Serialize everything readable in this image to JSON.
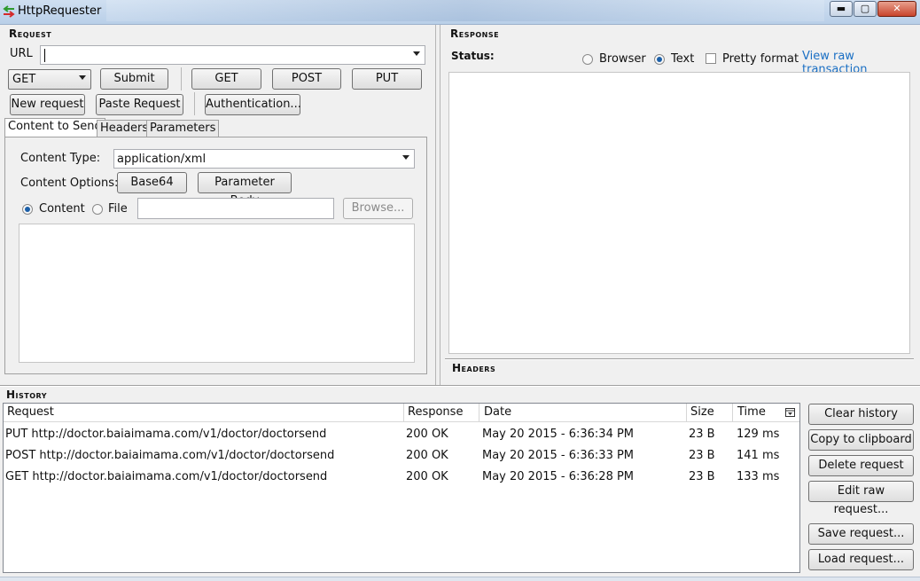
{
  "window": {
    "title": "HttpRequester",
    "controls": {
      "minimize": "▬",
      "maximize": "▢",
      "close": "✕"
    }
  },
  "request": {
    "section_title": "Request",
    "url_label": "URL",
    "url_value": "",
    "method_selected": "GET",
    "submit_label": "Submit",
    "get_label": "GET",
    "post_label": "POST",
    "put_label": "PUT",
    "new_request_label": "New request",
    "paste_request_label": "Paste Request",
    "authentication_label": "Authentication...",
    "tabs": [
      "Content to Send",
      "Headers",
      "Parameters"
    ],
    "content_type_label": "Content Type:",
    "content_type_value": "application/xml",
    "content_options_label": "Content Options:",
    "base64_label": "Base64",
    "parameter_body_label": "Parameter Body",
    "content_radio_label": "Content",
    "file_radio_label": "File",
    "file_path_value": "",
    "browse_label": "Browse...",
    "body_value": ""
  },
  "response": {
    "section_title": "Response",
    "status_label": "Status:",
    "browser_label": "Browser",
    "text_label": "Text",
    "pretty_format_label": "Pretty format",
    "view_raw_label": "View raw transaction",
    "headers_title": "Headers"
  },
  "history": {
    "section_title": "History",
    "columns": [
      "Request",
      "Response",
      "Date",
      "Size",
      "Time"
    ],
    "rows": [
      {
        "request": "PUT http://doctor.baiaimama.com/v1/doctor/doctorsend",
        "response": "200 OK",
        "date": "May 20 2015 - 6:36:34 PM",
        "size": "23 B",
        "time": "129 ms"
      },
      {
        "request": "POST http://doctor.baiaimama.com/v1/doctor/doctorsend",
        "response": "200 OK",
        "date": "May 20 2015 - 6:36:33 PM",
        "size": "23 B",
        "time": "141 ms"
      },
      {
        "request": "GET http://doctor.baiaimama.com/v1/doctor/doctorsend",
        "response": "200 OK",
        "date": "May 20 2015 - 6:36:28 PM",
        "size": "23 B",
        "time": "133 ms"
      }
    ],
    "clear_history_label": "Clear history",
    "copy_clipboard_label": "Copy to clipboard",
    "delete_request_label": "Delete request",
    "edit_raw_label": "Edit raw request...",
    "save_request_label": "Save request...",
    "load_request_label": "Load request..."
  },
  "colors": {
    "accent_link": "#1a6fc4",
    "radio_selected": "#1b5fa8"
  }
}
